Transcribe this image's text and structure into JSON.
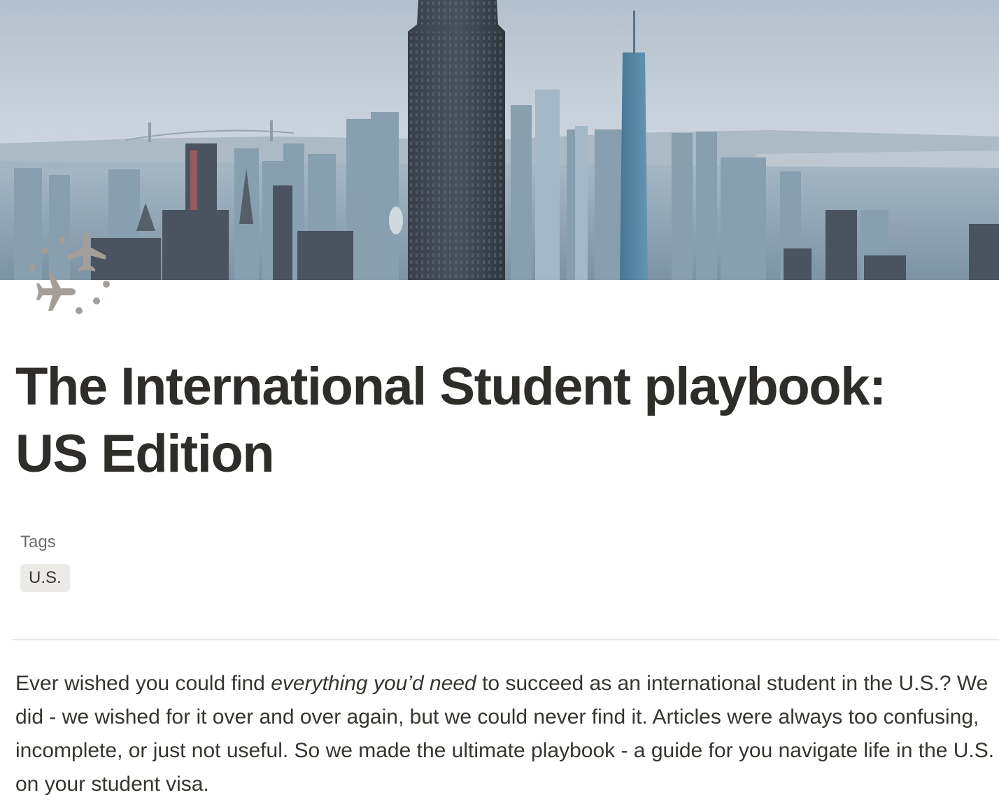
{
  "page": {
    "icon": "airplanes-icon",
    "title_line1": "The International Student playbook:",
    "title_line2": "US Edition"
  },
  "cover": {
    "image": "new-york-city-skyline-photo"
  },
  "properties": {
    "tags_label": "Tags",
    "tags": [
      "U.S."
    ]
  },
  "intro": {
    "part1": "Ever wished you could find ",
    "emphasis": "everything you’d need",
    "part2": " to succeed as an international student in the U.S.? We did - we wished for it over and over again, but we could never find it. Articles were always too confusing, incomplete, or just not useful. So we made the ultimate playbook - a guide for you navigate life in the U.S. on your student visa."
  },
  "colors": {
    "text": "#37352f",
    "muted": "#6f6e69",
    "tag_bg": "#ebeae6",
    "divider": "#e6e5e2",
    "icon": "#a39e98"
  }
}
